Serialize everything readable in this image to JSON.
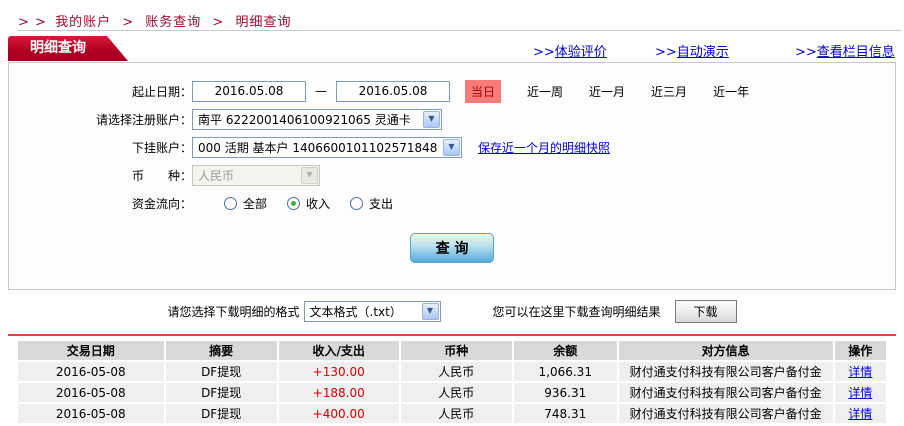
{
  "breadcrumb": {
    "prefix": "> >",
    "separator": ">",
    "items": [
      "我的账户",
      "账务查询",
      "明细查询"
    ]
  },
  "tab": {
    "label": "明细查询"
  },
  "header_links": [
    {
      "prefix": ">>",
      "label": "体验评价"
    },
    {
      "prefix": ">>",
      "label": "自动演示"
    },
    {
      "prefix": ">>",
      "label": "查看栏目信息"
    }
  ],
  "form": {
    "date_range": {
      "label": "起止日期：",
      "from": "2016.05.08",
      "dash": "—",
      "to": "2016.05.08",
      "quick_buttons": [
        {
          "label": "当日",
          "active": true
        },
        {
          "label": "近一周",
          "active": false
        },
        {
          "label": "近一月",
          "active": false
        },
        {
          "label": "近三月",
          "active": false
        },
        {
          "label": "近一年",
          "active": false
        }
      ]
    },
    "registered_account": {
      "label": "请选择注册账户：",
      "value": "南平 6222001406100921065 灵通卡"
    },
    "sub_account": {
      "label": "下挂账户：",
      "value": "000 活期 基本户 1406600101102571848",
      "snapshot_link": "保存近一个月的明细快照"
    },
    "currency": {
      "label": "币　　种：",
      "value": "人民币",
      "disabled": true
    },
    "flow": {
      "label": "资金流向：",
      "options": [
        {
          "label": "全部",
          "checked": false
        },
        {
          "label": "收入",
          "checked": true
        },
        {
          "label": "支出",
          "checked": false
        }
      ]
    },
    "query_button": "查 询"
  },
  "download": {
    "format_label": "请您选择下载明细的格式",
    "format_value": "文本格式（.txt）",
    "hint": "您可以在这里下载查询明细结果",
    "button": "下载"
  },
  "table": {
    "headers": [
      "交易日期",
      "摘要",
      "收入/支出",
      "币种",
      "余额",
      "对方信息",
      "操作"
    ],
    "rows": [
      {
        "date": "2016-05-08",
        "summary": "DF提现",
        "amount": "+130.00",
        "currency": "人民币",
        "balance": "1,066.31",
        "counterparty": "财付通支付科技有限公司客户备付金",
        "action": "详情"
      },
      {
        "date": "2016-05-08",
        "summary": "DF提现",
        "amount": "+188.00",
        "currency": "人民币",
        "balance": "936.31",
        "counterparty": "财付通支付科技有限公司客户备付金",
        "action": "详情"
      },
      {
        "date": "2016-05-08",
        "summary": "DF提现",
        "amount": "+400.00",
        "currency": "人民币",
        "balance": "748.31",
        "counterparty": "财付通支付科技有限公司客户备付金",
        "action": "详情"
      }
    ]
  },
  "colors": {
    "accent_red": "#b00022",
    "breadcrumb_red": "#9e0b2e",
    "link_blue": "#0000cd",
    "amount_red": "#d00000",
    "highlight_pink": "#f87d7a",
    "divider_red": "#e8423c",
    "table_header_gray": "#d9d9d9",
    "table_row_gray": "#efefef"
  }
}
